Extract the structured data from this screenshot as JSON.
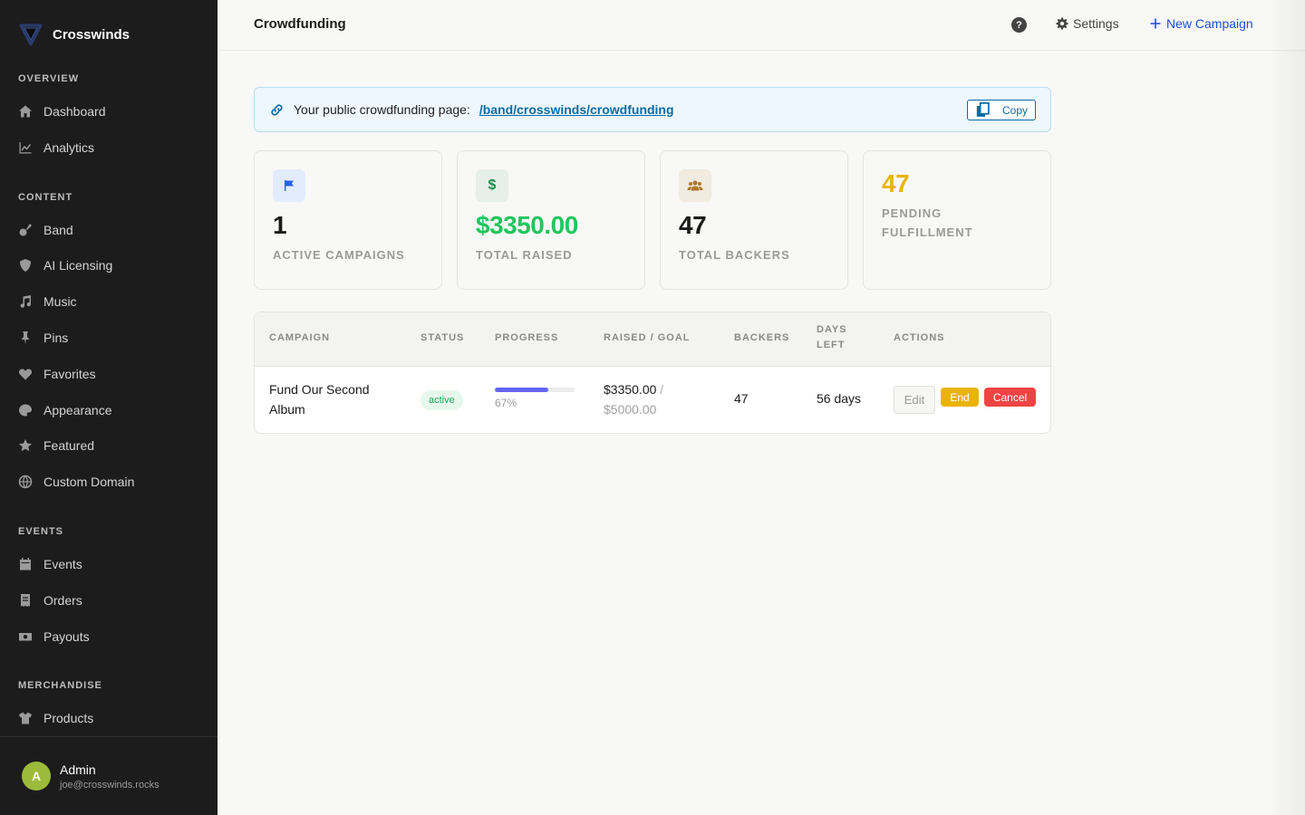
{
  "sidebar": {
    "brand": "Crosswinds",
    "sections": {
      "overview": "OVERVIEW",
      "content": "CONTENT",
      "events": "EVENTS",
      "merchandise": "MERCHANDISE"
    },
    "items": {
      "dashboard": "Dashboard",
      "analytics": "Analytics",
      "band": "Band",
      "ai_licensing": "AI Licensing",
      "music": "Music",
      "pins": "Pins",
      "favorites": "Favorites",
      "appearance": "Appearance",
      "featured": "Featured",
      "custom_domain": "Custom Domain",
      "events": "Events",
      "orders": "Orders",
      "payouts": "Payouts",
      "products": "Products"
    },
    "user": {
      "initial": "A",
      "name": "Admin",
      "email": "joe@crosswinds.rocks"
    }
  },
  "header": {
    "title": "Crowdfunding",
    "help": "?",
    "settings": "Settings",
    "new_campaign": "New Campaign"
  },
  "banner": {
    "label": "Your public crowdfunding page:",
    "link": "/band/crosswinds/crowdfunding",
    "copy": "Copy"
  },
  "stats": {
    "active_campaigns": {
      "value": "1",
      "label": "ACTIVE CAMPAIGNS"
    },
    "total_raised": {
      "value": "$3350.00",
      "label": "TOTAL RAISED"
    },
    "total_backers": {
      "value": "47",
      "label": "TOTAL BACKERS"
    },
    "pending_fulfillment": {
      "value": "47",
      "label": "PENDING FULFILLMENT"
    }
  },
  "table": {
    "headers": {
      "campaign": "CAMPAIGN",
      "status": "STATUS",
      "progress": "PROGRESS",
      "raised_goal": "RAISED / GOAL",
      "backers": "BACKERS",
      "days_left": "DAYS LEFT",
      "actions": "ACTIONS"
    },
    "rows": [
      {
        "campaign": "Fund Our Second Album",
        "status": "active",
        "progress_percent": 67,
        "progress_label": "67%",
        "raised": "$3350.00",
        "separator": "/",
        "goal": "$5000.00",
        "backers": "47",
        "days_left": "56 days",
        "actions": {
          "edit": "Edit",
          "end": "End",
          "cancel": "Cancel"
        }
      }
    ]
  },
  "colors": {
    "accent": "#1d4ed8",
    "raised_green": "#22c55e",
    "pending_yellow": "#eab308",
    "progress": "#6366f1",
    "end_button": "#eab308",
    "cancel_button": "#ef4444"
  },
  "icons": {
    "dashboard": "home-icon",
    "analytics": "chart-line-icon",
    "band": "guitar-icon",
    "ai_licensing": "shield-icon",
    "music": "music-note-icon",
    "pins": "pin-icon",
    "favorites": "heart-icon",
    "appearance": "palette-icon",
    "featured": "star-icon",
    "custom_domain": "globe-icon",
    "events": "calendar-icon",
    "orders": "receipt-icon",
    "payouts": "money-icon",
    "products": "shirt-icon"
  }
}
